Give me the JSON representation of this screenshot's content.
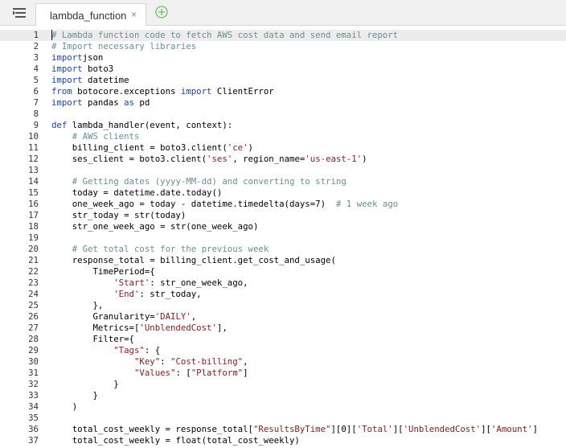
{
  "tabs": [
    {
      "label": "lambda_function",
      "close": "×",
      "active": true
    }
  ],
  "editor": {
    "lines": [
      {
        "n": "1",
        "t": [
          [
            "cm",
            "# Lambda function code to fetch AWS cost data and send email report"
          ]
        ]
      },
      {
        "n": "2",
        "t": [
          [
            "cm",
            "# Import necessary libraries"
          ]
        ]
      },
      {
        "n": "3",
        "t": [
          [
            "kw",
            "import"
          ],
          [
            "",
            "json"
          ]
        ]
      },
      {
        "n": "4",
        "t": [
          [
            "kw",
            "import"
          ],
          [
            "",
            " boto3"
          ]
        ]
      },
      {
        "n": "5",
        "t": [
          [
            "kw",
            "import"
          ],
          [
            "",
            " datetime"
          ]
        ]
      },
      {
        "n": "6",
        "t": [
          [
            "kw",
            "from"
          ],
          [
            "",
            " botocore.exceptions "
          ],
          [
            "kw",
            "import"
          ],
          [
            "",
            " ClientError"
          ]
        ]
      },
      {
        "n": "7",
        "t": [
          [
            "kw",
            "import"
          ],
          [
            "",
            " pandas "
          ],
          [
            "kw",
            "as"
          ],
          [
            "",
            " pd"
          ]
        ]
      },
      {
        "n": "8",
        "t": []
      },
      {
        "n": "9",
        "t": [
          [
            "kw",
            "def"
          ],
          [
            "",
            " lambda_handler(event, context):"
          ]
        ]
      },
      {
        "n": "10",
        "t": [
          [
            "",
            "    "
          ],
          [
            "cm",
            "# AWS clients"
          ]
        ]
      },
      {
        "n": "11",
        "t": [
          [
            "",
            "    billing_client = boto3.client("
          ],
          [
            "st",
            "'ce'"
          ],
          [
            "",
            ")"
          ]
        ]
      },
      {
        "n": "12",
        "t": [
          [
            "",
            "    ses_client = boto3.client("
          ],
          [
            "st",
            "'ses'"
          ],
          [
            "",
            ", region_name="
          ],
          [
            "st",
            "'us-east-1'"
          ],
          [
            "",
            ")"
          ]
        ]
      },
      {
        "n": "13",
        "t": []
      },
      {
        "n": "14",
        "t": [
          [
            "",
            "    "
          ],
          [
            "cm",
            "# Getting dates (yyyy-MM-dd) and converting to string"
          ]
        ]
      },
      {
        "n": "15",
        "t": [
          [
            "",
            "    today = datetime.date.today()"
          ]
        ]
      },
      {
        "n": "16",
        "t": [
          [
            "",
            "    one_week_ago = today - datetime.timedelta(days=7)  "
          ],
          [
            "cm",
            "# 1 week ago"
          ]
        ]
      },
      {
        "n": "17",
        "t": [
          [
            "",
            "    str_today = str(today)"
          ]
        ]
      },
      {
        "n": "18",
        "t": [
          [
            "",
            "    str_one_week_ago = str(one_week_ago)"
          ]
        ]
      },
      {
        "n": "19",
        "t": []
      },
      {
        "n": "20",
        "t": [
          [
            "",
            "    "
          ],
          [
            "cm",
            "# Get total cost for the previous week"
          ]
        ]
      },
      {
        "n": "21",
        "t": [
          [
            "",
            "    response_total = billing_client.get_cost_and_usage("
          ]
        ]
      },
      {
        "n": "22",
        "t": [
          [
            "",
            "        TimePeriod={"
          ]
        ]
      },
      {
        "n": "23",
        "t": [
          [
            "",
            "            "
          ],
          [
            "st",
            "'Start'"
          ],
          [
            "",
            ": str_one_week_ago,"
          ]
        ]
      },
      {
        "n": "24",
        "t": [
          [
            "",
            "            "
          ],
          [
            "st",
            "'End'"
          ],
          [
            "",
            ": str_today,"
          ]
        ]
      },
      {
        "n": "25",
        "t": [
          [
            "",
            "        },"
          ]
        ]
      },
      {
        "n": "26",
        "t": [
          [
            "",
            "        Granularity="
          ],
          [
            "st",
            "'DAILY'"
          ],
          [
            "",
            ","
          ]
        ]
      },
      {
        "n": "27",
        "t": [
          [
            "",
            "        Metrics=["
          ],
          [
            "st",
            "'UnblendedCost'"
          ],
          [
            "",
            "],"
          ]
        ]
      },
      {
        "n": "28",
        "t": [
          [
            "",
            "        Filter={"
          ]
        ]
      },
      {
        "n": "29",
        "t": [
          [
            "",
            "            "
          ],
          [
            "st",
            "\"Tags\""
          ],
          [
            "",
            ": {"
          ]
        ]
      },
      {
        "n": "30",
        "t": [
          [
            "",
            "                "
          ],
          [
            "st",
            "\"Key\""
          ],
          [
            "",
            ": "
          ],
          [
            "st",
            "\"Cost-billing\""
          ],
          [
            "",
            ","
          ]
        ]
      },
      {
        "n": "31",
        "t": [
          [
            "",
            "                "
          ],
          [
            "st",
            "\"Values\""
          ],
          [
            "",
            ": ["
          ],
          [
            "st",
            "\"Platform\""
          ],
          [
            "",
            "]"
          ]
        ]
      },
      {
        "n": "32",
        "t": [
          [
            "",
            "            }"
          ]
        ]
      },
      {
        "n": "33",
        "t": [
          [
            "",
            "        }"
          ]
        ]
      },
      {
        "n": "34",
        "t": [
          [
            "",
            "    )"
          ]
        ]
      },
      {
        "n": "35",
        "t": []
      },
      {
        "n": "36",
        "t": [
          [
            "",
            "    total_cost_weekly = response_total["
          ],
          [
            "st",
            "\"ResultsByTime\""
          ],
          [
            "",
            "][0]["
          ],
          [
            "st",
            "'Total'"
          ],
          [
            "",
            "]["
          ],
          [
            "st",
            "'UnblendedCost'"
          ],
          [
            "",
            "]["
          ],
          [
            "st",
            "'Amount'"
          ],
          [
            "",
            "]"
          ]
        ]
      },
      {
        "n": "37",
        "t": [
          [
            "",
            "    total_cost_weekly = float(total_cost_weekly)"
          ]
        ]
      }
    ]
  },
  "colors": {
    "keyword": "#1a3fb8",
    "comment": "#6a8f8f",
    "string": "#8a1a1a",
    "active_line": "#ececec",
    "add_icon": "#6fbf5f"
  },
  "icons": {
    "menu": "menu-icon",
    "close": "close-icon",
    "add": "add-tab-icon"
  }
}
